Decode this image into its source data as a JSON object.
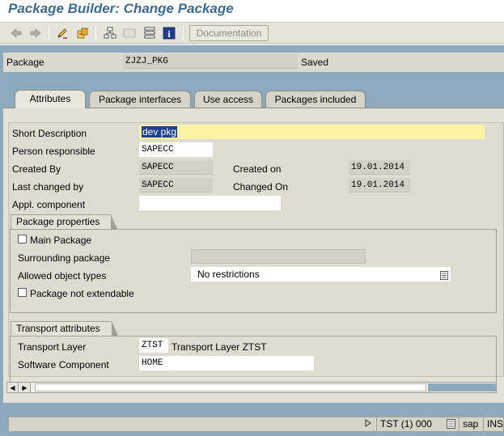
{
  "window": {
    "title": "Package Builder: Change Package"
  },
  "toolbar": {
    "documentation_label": "Documentation"
  },
  "header": {
    "package_label": "Package",
    "package_value": "ZJZJ_PKG",
    "status": "Saved"
  },
  "tabs": [
    {
      "label": "Attributes",
      "active": true
    },
    {
      "label": "Package interfaces",
      "active": false
    },
    {
      "label": "Use access",
      "active": false
    },
    {
      "label": "Packages included",
      "active": false
    }
  ],
  "attributes": {
    "short_description_label": "Short Description",
    "short_description_value": "dev pkg",
    "person_responsible_label": "Person responsible",
    "person_responsible_value": "SAPECC",
    "created_by_label": "Created By",
    "created_by_value": "SAPECC",
    "created_on_label": "Created on",
    "created_on_value": "19.01.2014",
    "last_changed_by_label": "Last changed by",
    "last_changed_by_value": "SAPECC",
    "changed_on_label": "Changed On",
    "changed_on_value": "19.01.2014",
    "appl_component_label": "Appl. component",
    "appl_component_value": ""
  },
  "package_properties": {
    "group_title": "Package properties",
    "main_package_label": "Main Package",
    "main_package_checked": false,
    "surrounding_package_label": "Surrounding package",
    "surrounding_package_value": "",
    "allowed_object_types_label": "Allowed object types",
    "allowed_object_types_value": "No restrictions",
    "not_extendable_label": "Package not extendable",
    "not_extendable_checked": false
  },
  "transport_attributes": {
    "group_title": "Transport attributes",
    "transport_layer_label": "Transport Layer",
    "transport_layer_value": "ZTST",
    "transport_layer_desc": "Transport Layer ZTST",
    "software_component_label": "Software Component",
    "software_component_value": "HOME"
  },
  "statusbar": {
    "system": "TST (1) 000",
    "server": "sap",
    "mode": "INS"
  },
  "colors": {
    "title": "#3f6a8e",
    "background_blue": "#8fa9bc",
    "highlight_field": "#fbf3a2",
    "panel": "#e3e1d7"
  }
}
